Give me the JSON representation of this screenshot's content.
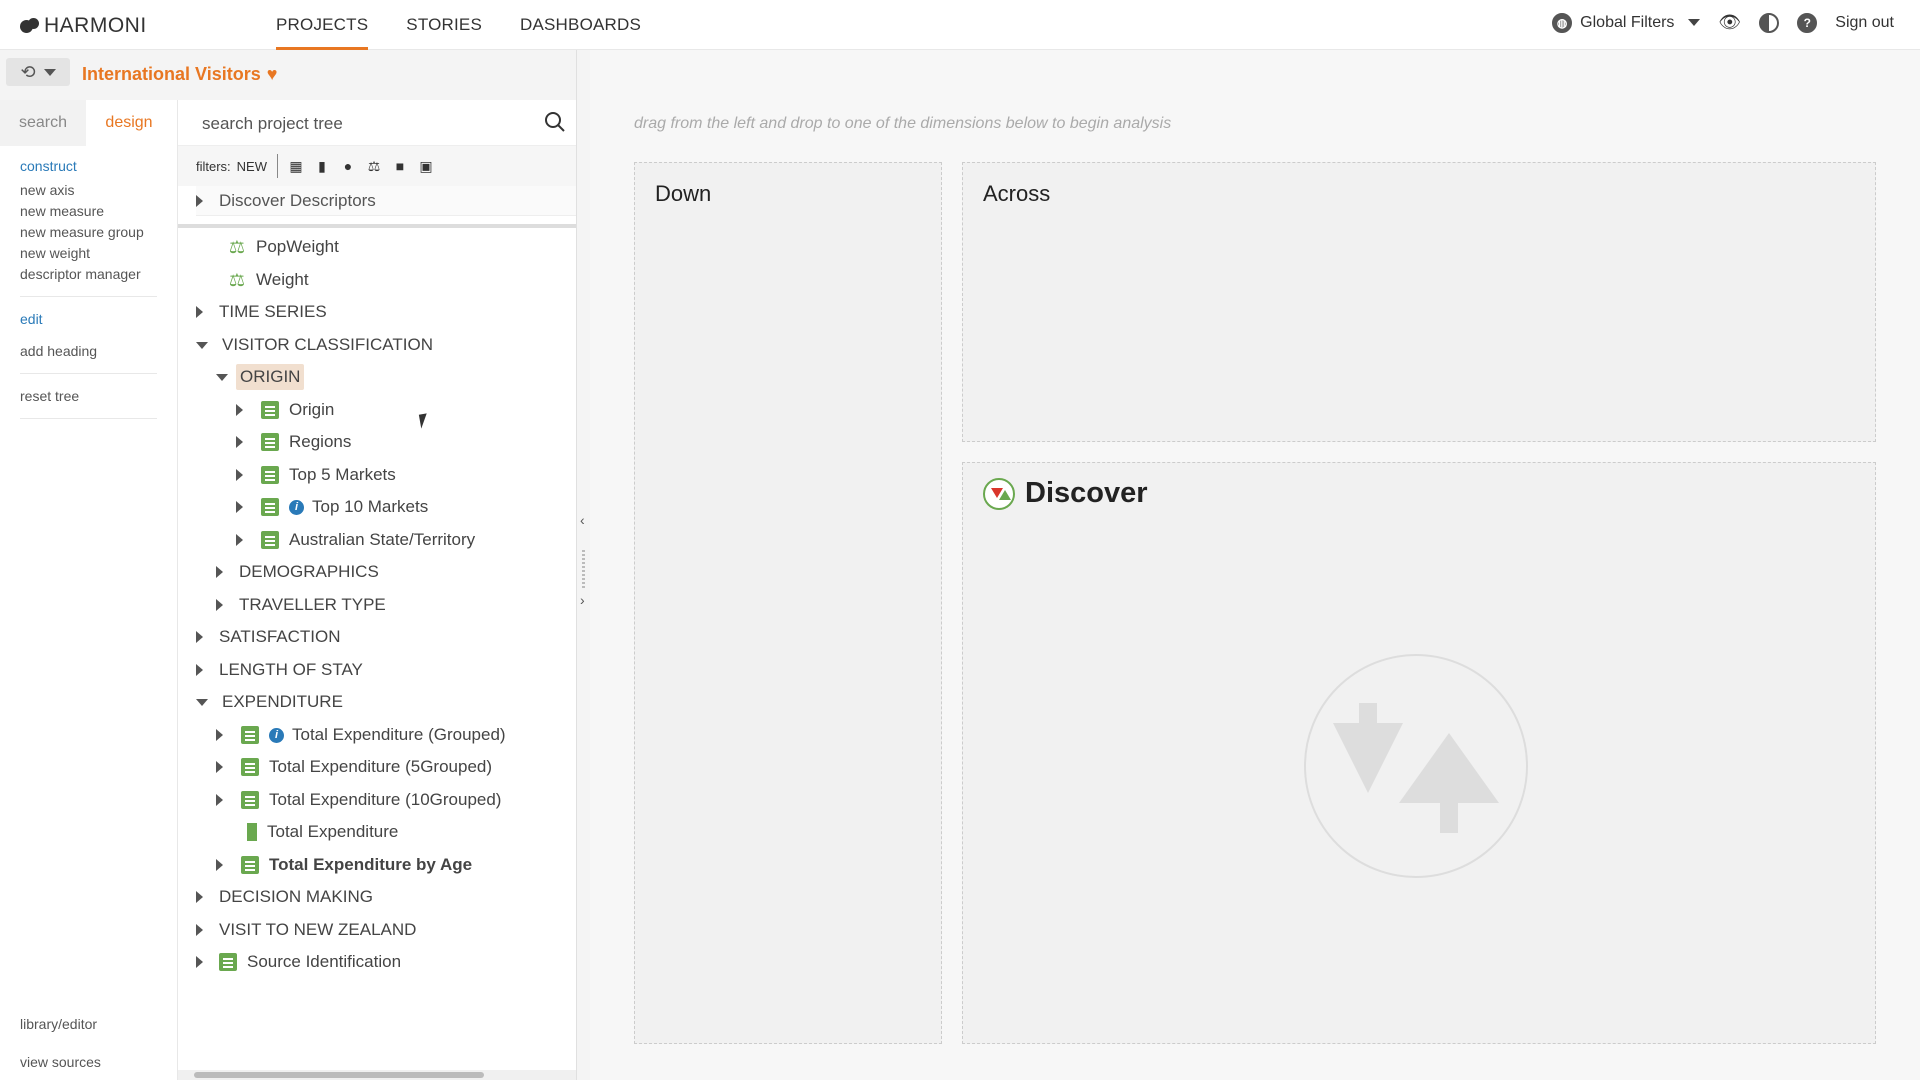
{
  "app": {
    "logo_text": "HARMONI"
  },
  "nav": {
    "tabs": [
      "PROJECTS",
      "STORIES",
      "DASHBOARDS"
    ],
    "active": "PROJECTS"
  },
  "topright": {
    "global_filters": "Global Filters",
    "sign_out": "Sign out"
  },
  "project": {
    "title": "International Visitors"
  },
  "leftrail": {
    "tabs": {
      "search": "search",
      "design": "design"
    },
    "construct_head": "construct",
    "construct_items": [
      "new axis",
      "new measure",
      "new measure group",
      "new weight",
      "descriptor manager"
    ],
    "edit_head": "edit",
    "edit_items": [
      "add heading"
    ],
    "reset": "reset tree",
    "bottom": [
      "library/editor",
      "view sources"
    ]
  },
  "tree": {
    "search_placeholder": "search project tree",
    "filters_label": "filters:",
    "filters_new": "NEW",
    "rows": [
      {
        "label": "Discover Descriptors"
      },
      {
        "label": "PopWeight"
      },
      {
        "label": "Weight"
      },
      {
        "label": "TIME SERIES"
      },
      {
        "label": "VISITOR CLASSIFICATION"
      },
      {
        "label": "ORIGIN"
      },
      {
        "label": "Origin"
      },
      {
        "label": "Regions"
      },
      {
        "label": "Top 5 Markets"
      },
      {
        "label": "Top 10 Markets"
      },
      {
        "label": "Australian State/Territory"
      },
      {
        "label": "DEMOGRAPHICS"
      },
      {
        "label": "TRAVELLER TYPE"
      },
      {
        "label": "SATISFACTION"
      },
      {
        "label": "LENGTH OF STAY"
      },
      {
        "label": "EXPENDITURE"
      },
      {
        "label": "Total Expenditure (Grouped)"
      },
      {
        "label": "Total Expenditure (5Grouped)"
      },
      {
        "label": "Total Expenditure (10Grouped)"
      },
      {
        "label": "Total Expenditure"
      },
      {
        "label": "Total Expenditure by Age"
      },
      {
        "label": "DECISION MAKING"
      },
      {
        "label": "VISIT TO NEW ZEALAND"
      },
      {
        "label": "Source Identification"
      }
    ]
  },
  "main": {
    "hint": "drag from the left and drop to one of the dimensions below to begin analysis",
    "down": "Down",
    "across": "Across",
    "discover": "Discover"
  },
  "colors": {
    "accent": "#e87722",
    "link": "#2a7ab8",
    "green": "#6aa84f"
  }
}
